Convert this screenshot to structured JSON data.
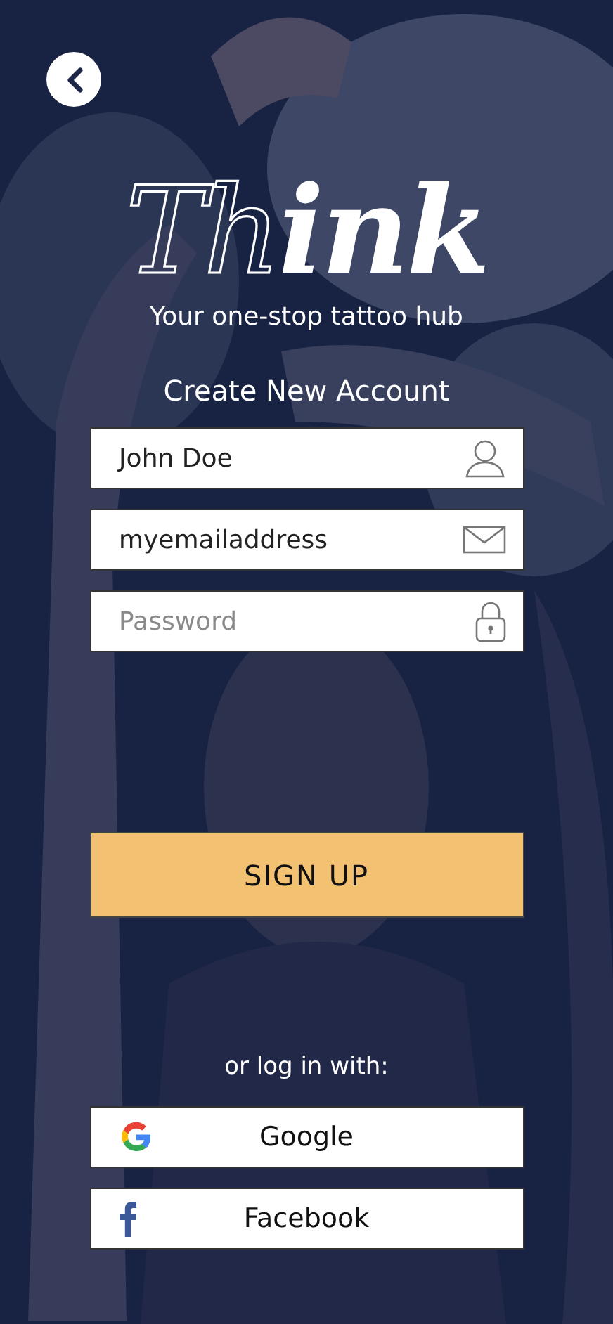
{
  "logo": {
    "parts": [
      "Th",
      "ink"
    ]
  },
  "tagline": "Your one-stop tattoo hub",
  "form": {
    "title": "Create New Account",
    "fields": [
      {
        "kind": "name",
        "value": "John Doe"
      },
      {
        "kind": "email",
        "value": "myemailaddress"
      },
      {
        "kind": "password",
        "placeholder": "Password"
      }
    ],
    "submit": "SIGN UP"
  },
  "alt_login": {
    "prompt": "or log in with:",
    "providers": [
      {
        "kind": "google",
        "label": "Google"
      },
      {
        "kind": "facebook",
        "label": "Facebook"
      }
    ]
  }
}
